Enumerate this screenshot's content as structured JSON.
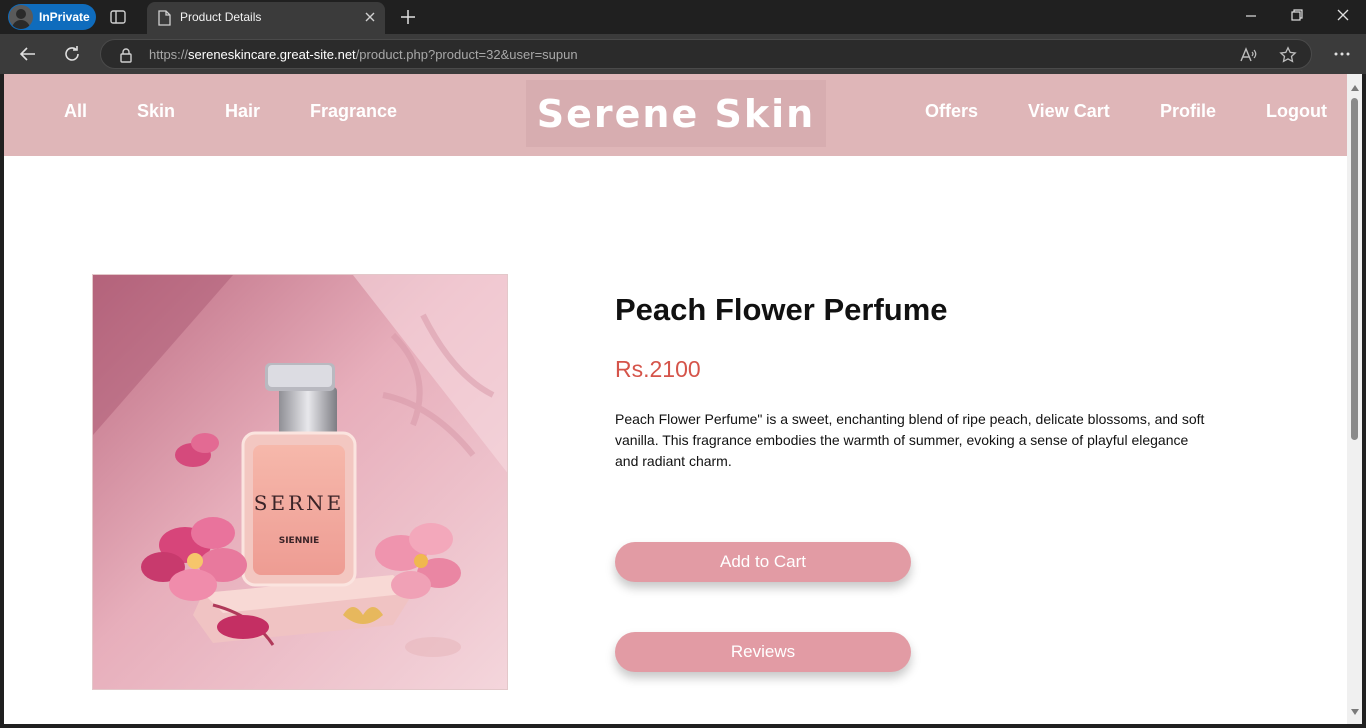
{
  "browser": {
    "inprivate_label": "InPrivate",
    "tab_title": "Product Details",
    "url": {
      "prefix": "https://",
      "domain": "sereneskincare.great-site.net",
      "path": "/product.php?product=32&user=supun"
    }
  },
  "nav": {
    "left": [
      "All",
      "Skin",
      "Hair",
      "Fragrance"
    ],
    "logo": "Serene Skin",
    "right": [
      "Offers",
      "View Cart",
      "Profile",
      "Logout"
    ]
  },
  "product": {
    "name": "Peach Flower Perfume",
    "price": "Rs.2100",
    "description": "Peach Flower Perfume\" is a sweet, enchanting blend of ripe peach, delicate blossoms, and soft vanilla. This fragrance embodies the warmth of summer, evoking a sense of playful elegance and radiant charm.",
    "bottle_text": "SERNE",
    "bottle_brand": "SIENNIE",
    "add_to_cart_label": "Add to Cart",
    "reviews_label": "Reviews"
  },
  "colors": {
    "nav_bg": "#dfb6b8",
    "button_bg": "#e29ba4",
    "price": "#d5544a",
    "inprivate": "#0f6cbd"
  }
}
